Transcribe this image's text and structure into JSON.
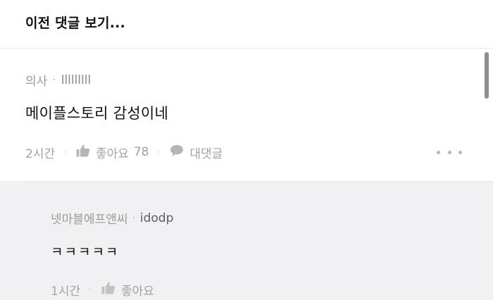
{
  "header": {
    "prev_comments_label": "이전 댓글 보기..."
  },
  "comment": {
    "author": "의사",
    "user_id": "lllllllll",
    "text": "메이플스토리 감성이네",
    "time": "2시간",
    "like_label": "좋아요",
    "like_count": "78",
    "reply_label": "대댓글"
  },
  "reply": {
    "author": "넷마블에프앤씨",
    "user_id": "idodp",
    "text": "ㅋㅋㅋㅋㅋ",
    "time": "1시간",
    "like_label": "좋아요"
  },
  "icons": {
    "thumb": "thumbs-up-icon",
    "reply": "speech-bubble-icon",
    "more": "more-dots-icon"
  },
  "colors": {
    "text_primary": "#111111",
    "text_secondary": "#a2a2a2",
    "reply_background": "#f1f1f3",
    "reply_user_id": "#555e6b"
  }
}
